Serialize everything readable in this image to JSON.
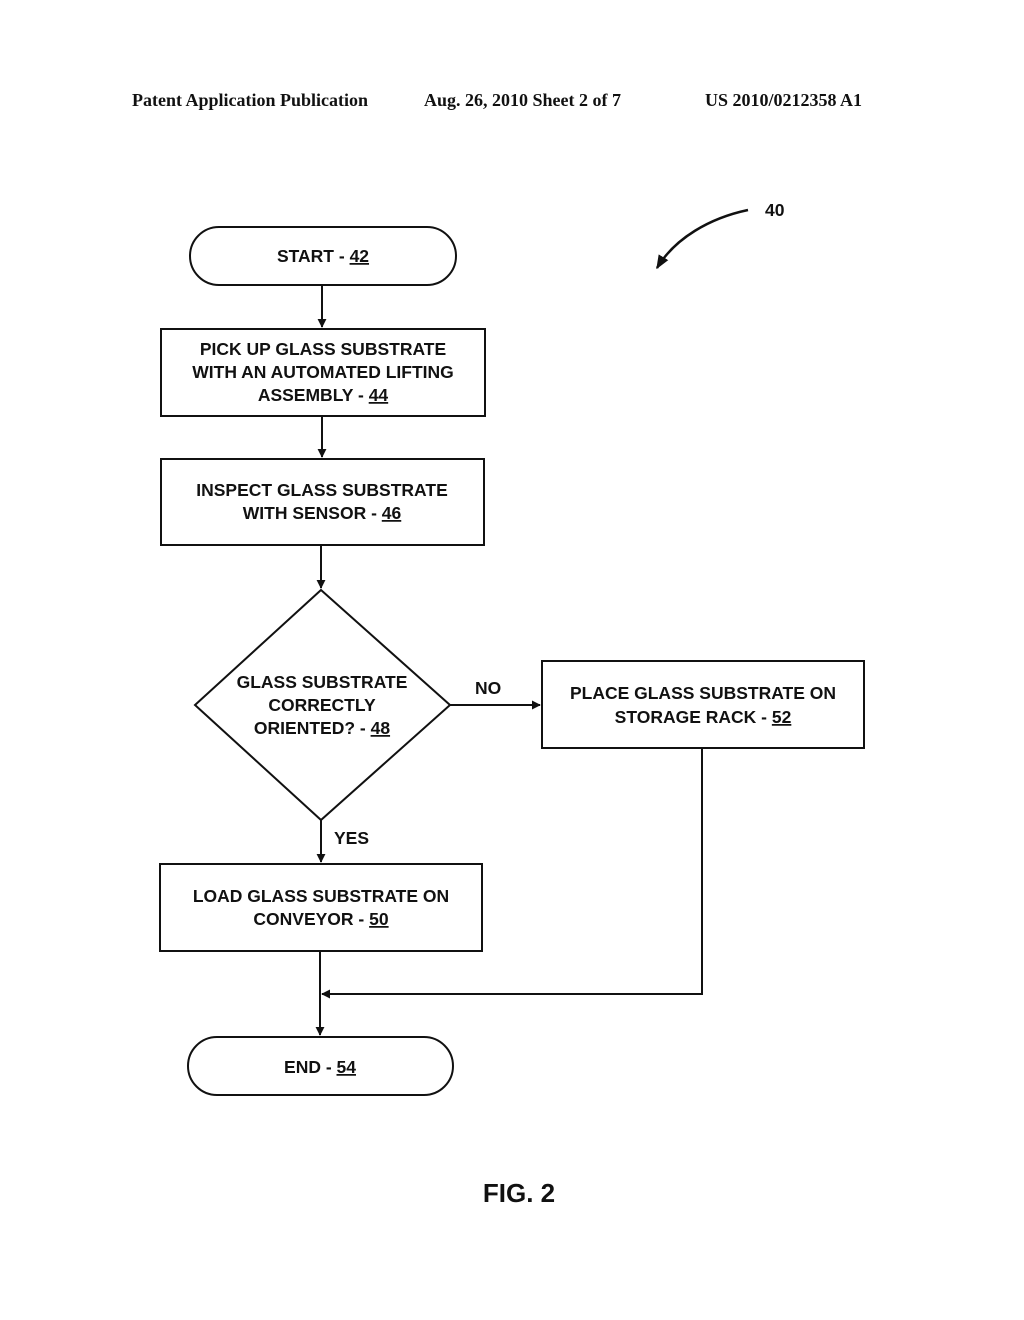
{
  "header": {
    "publication": "Patent Application Publication",
    "date_sheet": "Aug. 26, 2010  Sheet 2 of 7",
    "number": "US 2010/0212358 A1"
  },
  "figure": {
    "ref": "40",
    "caption": "FIG. 2"
  },
  "nodes": {
    "start": {
      "lines": [
        "START - "
      ],
      "num": "42"
    },
    "pickup": {
      "lines": [
        "PICK UP GLASS SUBSTRATE",
        "WITH AN AUTOMATED LIFTING",
        "ASSEMBLY - "
      ],
      "num": "44"
    },
    "inspect": {
      "lines": [
        "INSPECT GLASS SUBSTRATE",
        "WITH SENSOR - "
      ],
      "num": "46"
    },
    "decision": {
      "lines": [
        "GLASS SUBSTRATE",
        "CORRECTLY",
        "ORIENTED? - "
      ],
      "num": "48"
    },
    "load": {
      "lines": [
        "LOAD GLASS SUBSTRATE ON",
        "CONVEYOR - "
      ],
      "num": "50"
    },
    "place": {
      "lines": [
        "PLACE GLASS SUBSTRATE ON",
        "STORAGE RACK - "
      ],
      "num": "52"
    },
    "end": {
      "lines": [
        "END - "
      ],
      "num": "54"
    }
  },
  "edges": {
    "no_label": "NO",
    "yes_label": "YES"
  }
}
